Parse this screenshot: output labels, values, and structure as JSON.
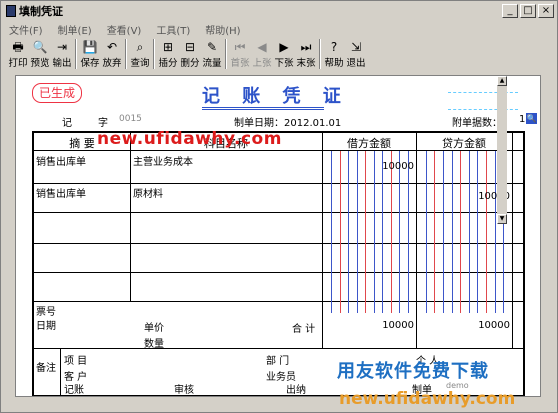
{
  "window": {
    "title": "填制凭证",
    "controls": [
      "_",
      "□",
      "×"
    ]
  },
  "menu": [
    "文件(F)",
    "制单(E)",
    "查看(V)",
    "工具(T)",
    "帮助(H)"
  ],
  "toolbar": [
    {
      "label": "打印",
      "icon": "printer-icon",
      "glyph": "🖶",
      "enabled": true
    },
    {
      "label": "预览",
      "icon": "preview-icon",
      "glyph": "🔍",
      "enabled": true
    },
    {
      "label": "输出",
      "icon": "export-icon",
      "glyph": "⇥",
      "enabled": true
    },
    {
      "label": "保存",
      "icon": "save-icon",
      "glyph": "💾",
      "enabled": true
    },
    {
      "label": "放弃",
      "icon": "undo-icon",
      "glyph": "↶",
      "enabled": true
    },
    {
      "label": "查询",
      "icon": "binoculars-icon",
      "glyph": "⌕",
      "enabled": true
    },
    {
      "label": "插分",
      "icon": "insert-row-icon",
      "glyph": "⊞",
      "enabled": true
    },
    {
      "label": "删分",
      "icon": "delete-row-icon",
      "glyph": "⊟",
      "enabled": true
    },
    {
      "label": "流量",
      "icon": "cashflow-icon",
      "glyph": "✎",
      "enabled": true
    },
    {
      "label": "首张",
      "icon": "first-icon",
      "glyph": "⏮",
      "enabled": false
    },
    {
      "label": "上张",
      "icon": "prev-icon",
      "glyph": "◀",
      "enabled": false
    },
    {
      "label": "下张",
      "icon": "next-icon",
      "glyph": "▶",
      "enabled": true
    },
    {
      "label": "末张",
      "icon": "last-icon",
      "glyph": "⏭",
      "enabled": true
    },
    {
      "label": "帮助",
      "icon": "help-icon",
      "glyph": "?",
      "enabled": true
    },
    {
      "label": "退出",
      "icon": "exit-icon",
      "glyph": "⇲",
      "enabled": true
    }
  ],
  "voucher": {
    "status": "已生成",
    "title": "记 账 凭 证",
    "word_label": "记",
    "zi_label": "字",
    "number": "0015",
    "date_label": "制单日期：2012.01.01",
    "attachments_label": "附单据数：",
    "attachments_count": "1",
    "headers": {
      "summary": "摘  要",
      "account": "科目名称",
      "debit": "借方金额",
      "credit": "贷方金额"
    },
    "rows": [
      {
        "summary": "销售出库单",
        "account": "主营业务成本",
        "debit": "10000",
        "credit": ""
      },
      {
        "summary": "销售出库单",
        "account": "原材料",
        "debit": "",
        "credit": "10000"
      },
      {
        "summary": "",
        "account": "",
        "debit": "",
        "credit": ""
      },
      {
        "summary": "",
        "account": "",
        "debit": "",
        "credit": ""
      }
    ],
    "footer": {
      "ticket_no_label": "票号",
      "date_label": "日期",
      "unit_price_label": "单价",
      "quantity_label": "数量",
      "total_label": "合 计",
      "total_debit": "10000",
      "total_credit": "10000",
      "notes_label": "备注",
      "project_label": "项  目",
      "customer_label": "客  户",
      "department_label": "部  门",
      "salesperson_label": "业务员",
      "individual_label": "个  人"
    },
    "signatures": {
      "bookkeeping": "记账",
      "audit": "审核",
      "cashier": "出纳",
      "maker_label": "制单",
      "maker": "demo"
    }
  },
  "watermarks": {
    "url_top": "new.ufidawhy.com",
    "brand": "用友软件免费下载",
    "url_bottom": "new.ufidawhy.com"
  }
}
